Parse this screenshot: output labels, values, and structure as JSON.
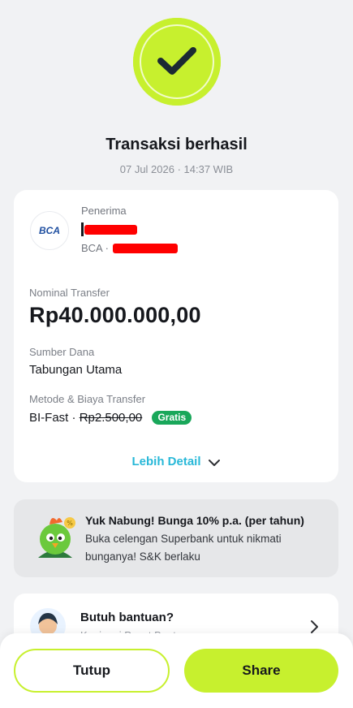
{
  "status": {
    "icon": "checkmark-icon",
    "title": "Transaksi berhasil",
    "timestamp": "07 Jul 2026 · 14:37 WIB"
  },
  "receipt": {
    "bank_logo_text": "BCA",
    "recipient_label": "Penerima",
    "recipient_name_visible": "I",
    "recipient_bank_prefix": "BCA ·",
    "amount_label": "Nominal Transfer",
    "amount": "Rp40.000.000,00",
    "source_label": "Sumber Dana",
    "source_value": "Tabungan Utama",
    "method_label": "Metode & Biaya Transfer",
    "method_prefix": "BI-Fast ·",
    "method_fee": "Rp2.500,00",
    "fee_badge": "Gratis",
    "detail_link": "Lebih Detail"
  },
  "promo": {
    "title": "Yuk Nabung! Bunga 10% p.a. (per tahun)",
    "text": "Buka celengan Superbank untuk nikmati bunganya! S&K berlaku"
  },
  "help": {
    "title": "Butuh bantuan?",
    "subtitle": "Kunjungi Pusat Bantuan"
  },
  "actions": {
    "close_label": "Tutup",
    "share_label": "Share"
  },
  "colors": {
    "accent_lime": "#c7f02e",
    "link_cyan": "#28b8d8",
    "badge_green": "#19a75a",
    "redaction_red": "#ff0000"
  }
}
